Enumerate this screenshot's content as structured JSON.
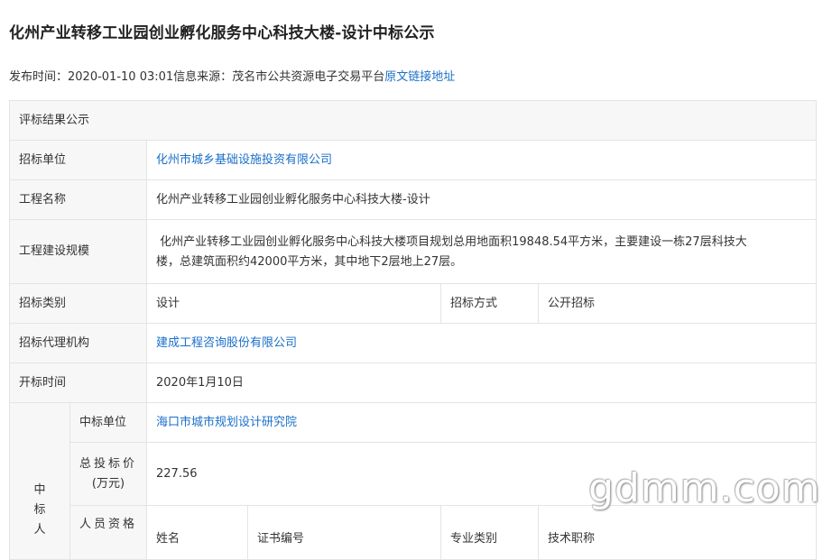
{
  "page": {
    "title": "化州产业转移工业园创业孵化服务中心科技大楼-设计中标公示",
    "publish_label": "发布时间：",
    "publish_time": "2020-01-10 03:01",
    "source_label": "信息来源：",
    "source": "茂名市公共资源电子交易平台",
    "original_link": "原文链接地址"
  },
  "table": {
    "section_title": "评标结果公示",
    "tenderer_label": "招标单位",
    "tenderer": "化州市城乡基础设施投资有限公司",
    "project_name_label": "工程名称",
    "project_name": "化州产业转移工业园创业孵化服务中心科技大楼-设计",
    "scale_label": "工程建设规模",
    "scale_line1": " 化州产业转移工业园创业孵化服务中心科技大楼项目规划总用地面积19848.54平方米，主要建设一栋27层科技大",
    "scale_line2": "楼，总建筑面积约42000平方米，其中地下2层地上27层。",
    "category_label": "招标类别",
    "category": "设计",
    "method_label": "招标方式",
    "method": "公开招标",
    "agency_label": "招标代理机构",
    "agency": "建成工程咨询股份有限公司",
    "open_time_label": "开标时间",
    "open_time": "2020年1月10日",
    "winner_group_chars": [
      "中",
      "标",
      "人"
    ],
    "winner_unit_label": "中标单位",
    "winner_unit": "海口市城市规划设计研究院",
    "total_price_label_1": "总投标价",
    "total_price_label_2": "(万元)",
    "total_price": "227.56",
    "personnel_label": "人员资格",
    "personnel_headers": [
      "姓名",
      "证书编号",
      "专业类别",
      "技术职称"
    ]
  },
  "watermark": "gdmm.com"
}
